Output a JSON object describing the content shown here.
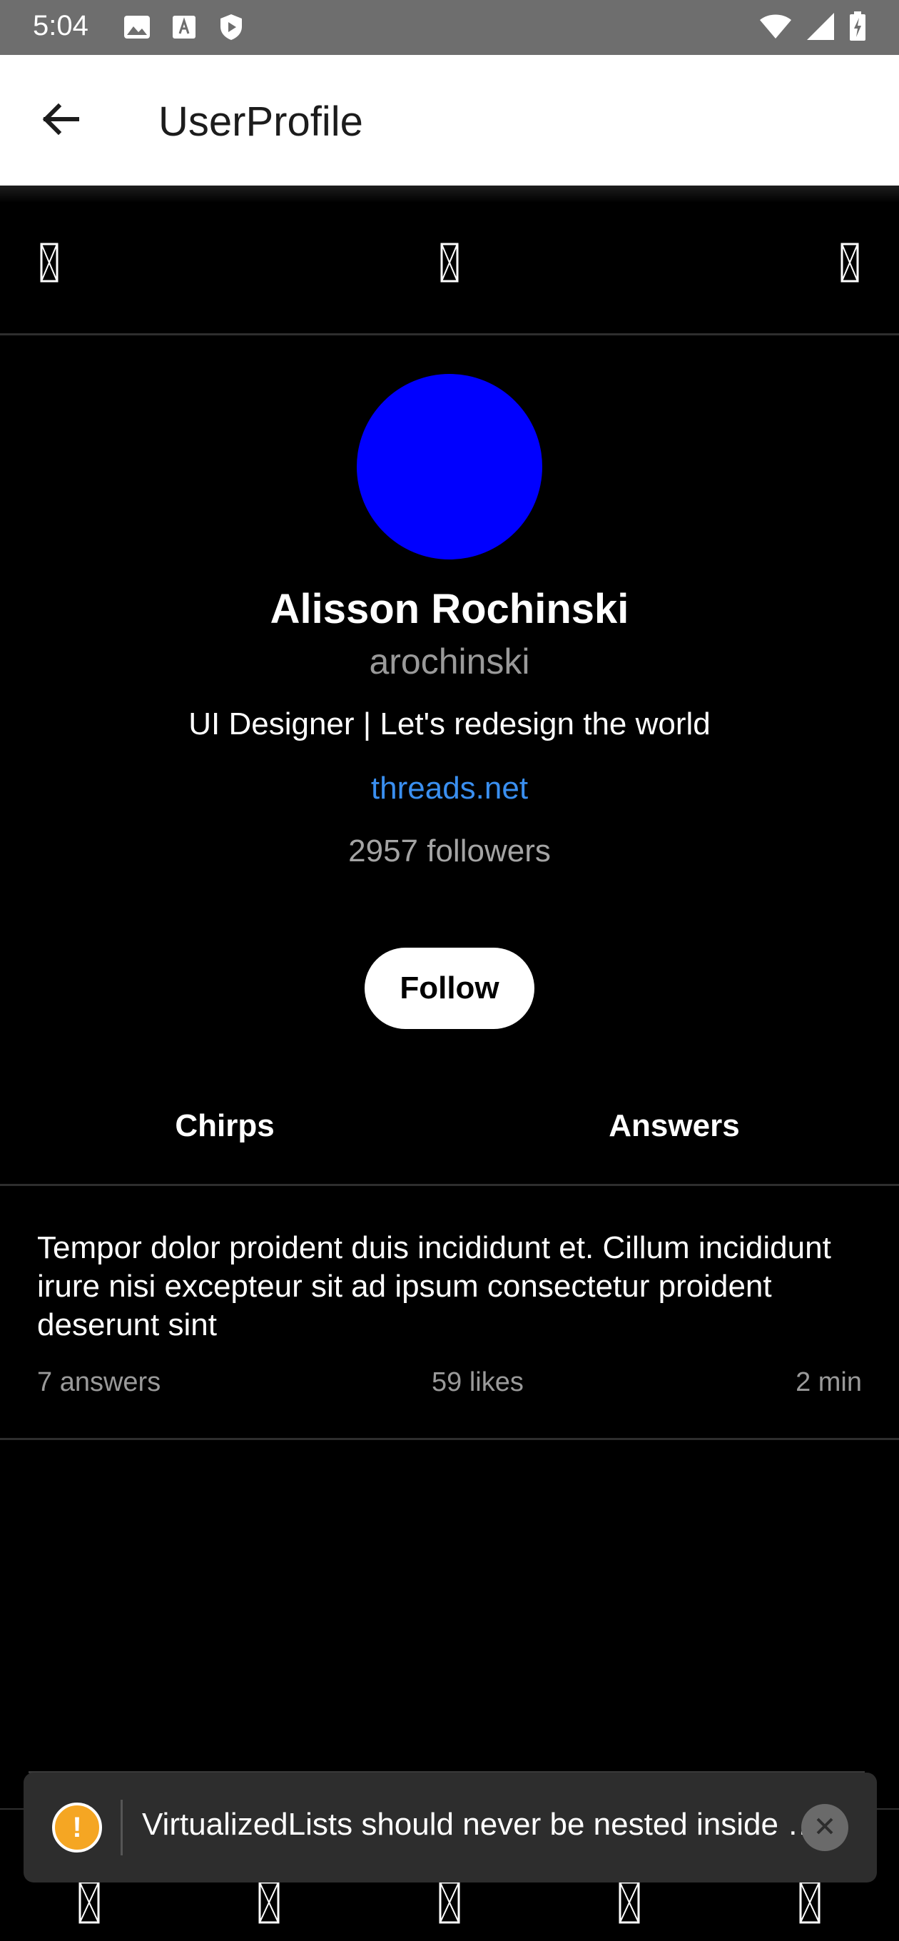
{
  "status_bar": {
    "time": "5:04",
    "left_icons": [
      "image-icon",
      "font-icon",
      "shield-play-icon"
    ],
    "right_icons": [
      "wifi-icon",
      "signal-icon",
      "battery-charging-icon"
    ]
  },
  "app_bar": {
    "back_icon": "arrow-left-icon",
    "title": "UserProfile"
  },
  "icon_row": {
    "icons": [
      "missing-glyph-icon",
      "missing-glyph-icon",
      "missing-glyph-icon"
    ]
  },
  "profile": {
    "avatar_color": "#0000ff",
    "name": "Alisson Rochinski",
    "username": "arochinski",
    "bio": "UI Designer | Let's redesign the world",
    "link": "threads.net",
    "followers": "2957 followers",
    "follow_label": "Follow"
  },
  "tabs": [
    {
      "label": "Chirps"
    },
    {
      "label": "Answers"
    }
  ],
  "posts": [
    {
      "text": "Tempor dolor proident duis incididunt et. Cillum incididunt irure nisi excepteur sit ad ipsum consectetur proident deserunt sint",
      "answers": "7 answers",
      "likes": "59 likes",
      "time": "2 min"
    }
  ],
  "bottom_nav": {
    "icons": [
      "missing-glyph-icon",
      "missing-glyph-icon",
      "missing-glyph-icon",
      "missing-glyph-icon",
      "missing-glyph-icon"
    ]
  },
  "toast": {
    "icon": "warning-icon",
    "icon_glyph": "!",
    "message": "VirtualizedLists should never be nested inside plain ScrollViews with the same orientation",
    "close_icon": "close-icon",
    "accent_color": "#f5a623"
  },
  "colors": {
    "background": "#000000",
    "link": "#3a8ff0",
    "muted_text": "#9a9a9a"
  }
}
